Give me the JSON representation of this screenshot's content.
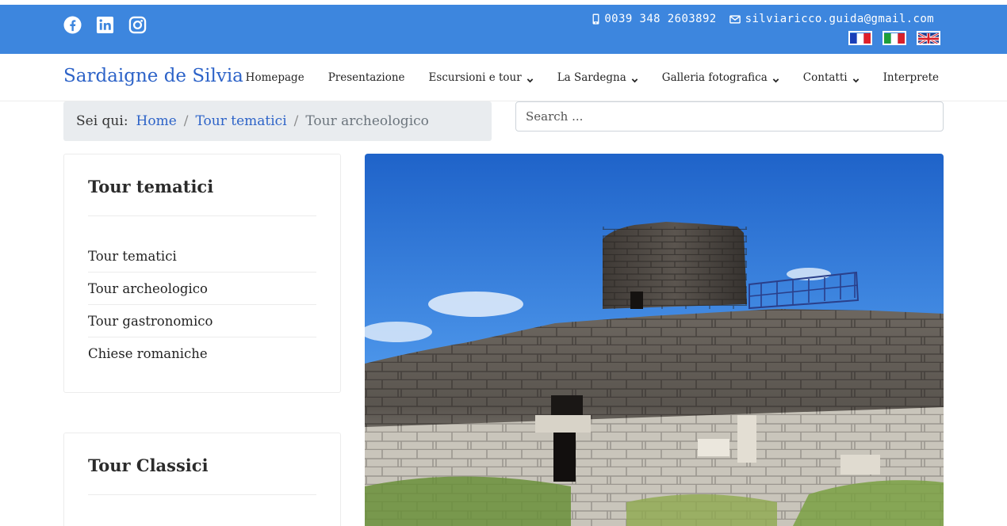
{
  "topbar": {
    "background": "#3d86de",
    "social": [
      "facebook-icon",
      "linkedin-icon",
      "instagram-icon"
    ],
    "phone": "0039 348 2603892",
    "email": "silviaricco.guida@gmail.com",
    "flags": [
      "flag-france-icon",
      "flag-italy-icon",
      "flag-uk-icon"
    ]
  },
  "navbar": {
    "brand": "Sardaigne de Silvia",
    "brand_color": "#2d63c8",
    "items": [
      {
        "label": "Homepage",
        "dropdown": false
      },
      {
        "label": "Presentazione",
        "dropdown": false
      },
      {
        "label": "Escursioni e tour",
        "dropdown": true
      },
      {
        "label": "La Sardegna",
        "dropdown": true
      },
      {
        "label": "Galleria fotografica",
        "dropdown": true
      },
      {
        "label": "Contatti",
        "dropdown": true
      },
      {
        "label": "Interprete",
        "dropdown": false
      }
    ]
  },
  "breadcrumb": {
    "label": "Sei qui:",
    "items": [
      "Home",
      "Tour tematici",
      "Tour archeologico"
    ]
  },
  "search": {
    "placeholder": "Search ..."
  },
  "sidebar": {
    "cards": [
      {
        "title": "Tour tematici",
        "items": [
          "Tour tematici",
          "Tour archeologico",
          "Tour gastronomico",
          "Chiese romaniche"
        ]
      },
      {
        "title": "Tour Classici",
        "items": []
      }
    ]
  }
}
